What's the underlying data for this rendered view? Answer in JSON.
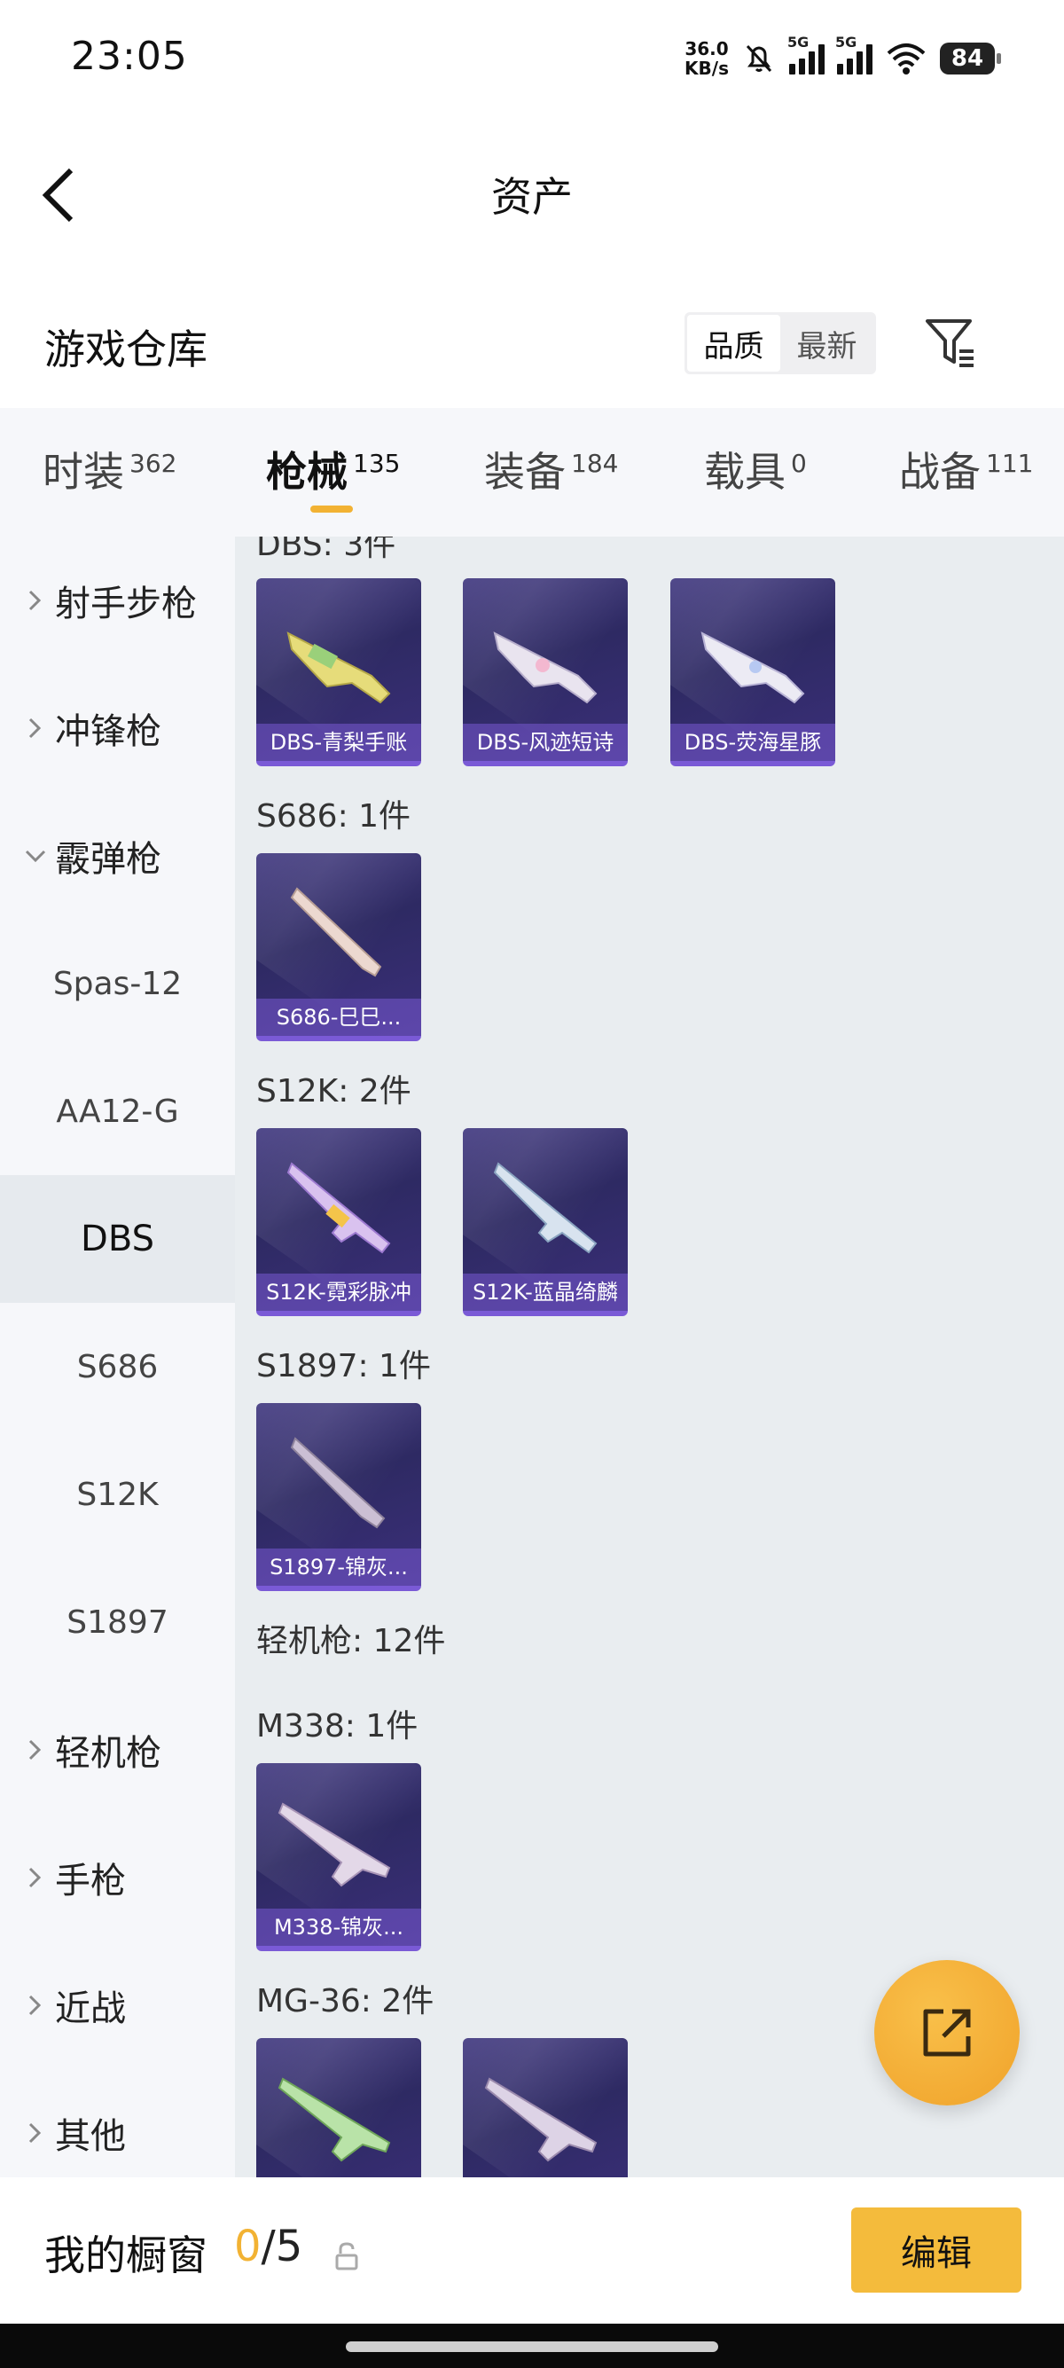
{
  "status_bar": {
    "time": "23:05",
    "net_speed": "36.0",
    "net_unit": "KB/s",
    "sim1_label": "5G",
    "sim2_label": "5G",
    "battery": "84"
  },
  "header": {
    "title": "资产",
    "back_icon": "chevron-left-icon"
  },
  "warehouse": {
    "title": "游戏仓库",
    "sort_options": [
      "品质",
      "最新"
    ],
    "sort_selected": "品质",
    "filter_icon": "filter-icon"
  },
  "tabs": [
    {
      "label": "时装",
      "count": "362"
    },
    {
      "label": "枪械",
      "count": "135",
      "active": true
    },
    {
      "label": "装备",
      "count": "184"
    },
    {
      "label": "载具",
      "count": "0"
    },
    {
      "label": "战备",
      "count": "111"
    }
  ],
  "sidebar": {
    "categories": [
      {
        "label": "射手步枪",
        "expanded": false
      },
      {
        "label": "冲锋枪",
        "expanded": false
      },
      {
        "label": "霰弹枪",
        "expanded": true
      },
      {
        "label": "Spas-12"
      },
      {
        "label": "AA12-G"
      },
      {
        "label": "DBS",
        "active": true
      },
      {
        "label": "S686"
      },
      {
        "label": "S12K"
      },
      {
        "label": "S1897"
      },
      {
        "label": "轻机枪",
        "expanded": false
      },
      {
        "label": "手枪",
        "expanded": false
      },
      {
        "label": "近战",
        "expanded": false
      },
      {
        "label": "其他",
        "expanded": false
      }
    ]
  },
  "content": {
    "groups": [
      {
        "label": "DBS: 3件",
        "items": [
          "DBS-青梨手账",
          "DBS-风迹短诗",
          "DBS-荧海星豚"
        ]
      },
      {
        "label": "S686: 1件",
        "items": [
          "S686-巳巳..."
        ]
      },
      {
        "label": "S12K: 2件",
        "items": [
          "S12K-霓彩脉冲",
          "S12K-蓝晶绮麟"
        ]
      },
      {
        "label": "S1897: 1件",
        "items": [
          "S1897-锦灰..."
        ]
      },
      {
        "label": "轻机枪: 12件",
        "items": []
      },
      {
        "label": "M338: 1件",
        "items": [
          "M338-锦灰..."
        ]
      },
      {
        "label": "MG-36: 2件",
        "items": [
          "",
          ""
        ]
      }
    ]
  },
  "fab": {
    "icon": "share-external-icon"
  },
  "bottom": {
    "title": "我的橱窗",
    "current": "0",
    "separator": "/",
    "max": "5",
    "lock_icon": "unlock-icon",
    "edit_label": "编辑"
  }
}
